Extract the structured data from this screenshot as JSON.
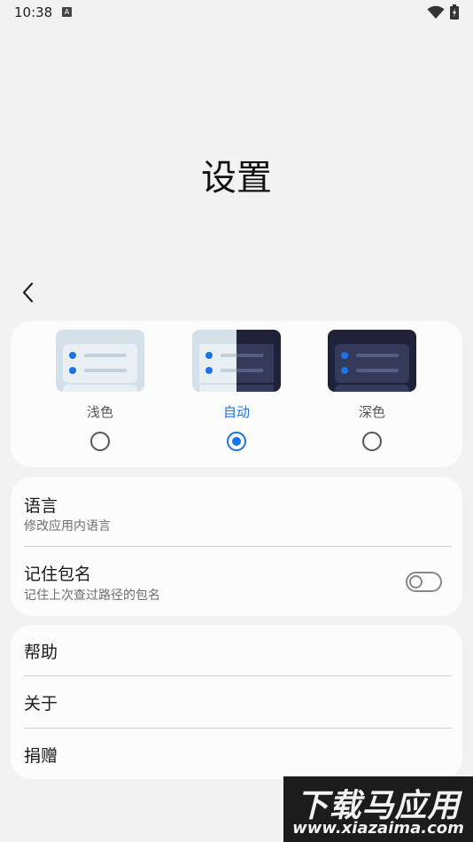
{
  "status_bar": {
    "time": "10:38",
    "notification_icon_letter": "A"
  },
  "page": {
    "title": "设置"
  },
  "theme": {
    "options": [
      {
        "label": "浅色",
        "selected": false
      },
      {
        "label": "自动",
        "selected": true
      },
      {
        "label": "深色",
        "selected": false
      }
    ],
    "accent_color": "#1a73e8"
  },
  "settings": {
    "language": {
      "title": "语言",
      "subtitle": "修改应用内语言"
    },
    "remember_package": {
      "title": "记住包名",
      "subtitle": "记住上次查过路径的包名",
      "enabled": false
    }
  },
  "misc": {
    "help": "帮助",
    "about": "关于",
    "donate": "捐赠"
  },
  "watermark": {
    "text": "下载马应用",
    "url": "www.xiazaima.com"
  }
}
